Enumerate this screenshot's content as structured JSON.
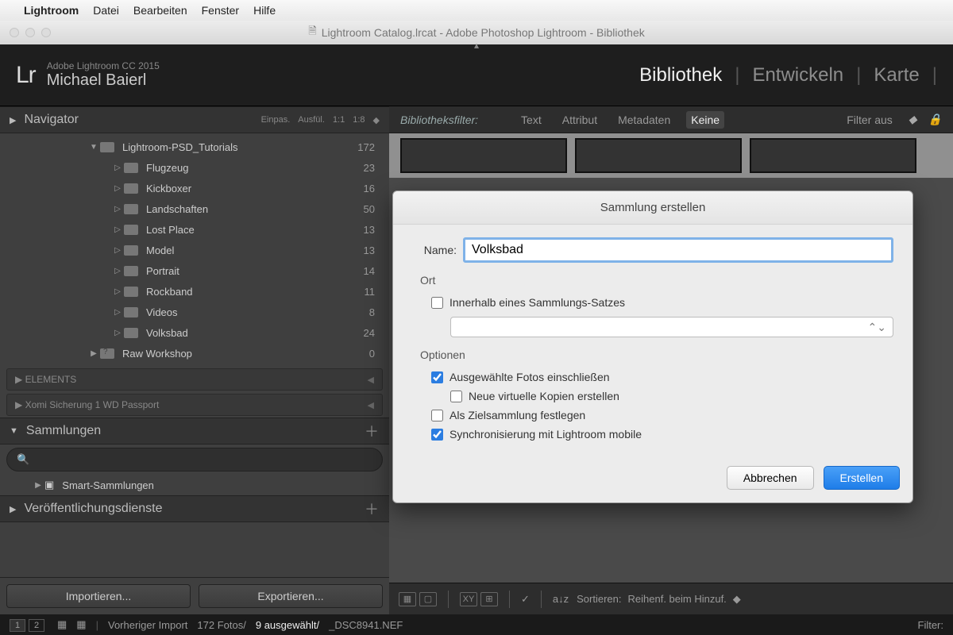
{
  "mac_menu": {
    "app": "Lightroom",
    "items": [
      "Datei",
      "Bearbeiten",
      "Fenster",
      "Hilfe"
    ]
  },
  "window_title": "Lightroom Catalog.lrcat - Adobe Photoshop Lightroom - Bibliothek",
  "identity": {
    "version": "Adobe Lightroom CC 2015",
    "user": "Michael Baierl",
    "logo": "Lr"
  },
  "modules": {
    "active": "Bibliothek",
    "m2": "Entwickeln",
    "m3": "Karte"
  },
  "navigator": {
    "title": "Navigator",
    "controls": [
      "Einpas.",
      "Ausfül.",
      "1:1",
      "1:8"
    ]
  },
  "folders": {
    "root": {
      "label": "Lightroom-PSD_Tutorials",
      "count": "172"
    },
    "children": [
      {
        "label": "Flugzeug",
        "count": "23"
      },
      {
        "label": "Kickboxer",
        "count": "16"
      },
      {
        "label": "Landschaften",
        "count": "50"
      },
      {
        "label": "Lost Place",
        "count": "13"
      },
      {
        "label": "Model",
        "count": "13"
      },
      {
        "label": "Portrait",
        "count": "14"
      },
      {
        "label": "Rockband",
        "count": "11"
      },
      {
        "label": "Videos",
        "count": "8"
      },
      {
        "label": "Volksbad",
        "count": "24"
      }
    ],
    "raw": {
      "label": "Raw Workshop",
      "count": "0"
    }
  },
  "elements_panel": "ELEMENTS",
  "drive_panel": "Xomi Sicherung 1 WD Passport",
  "sammlungen": {
    "title": "Sammlungen",
    "smart": "Smart-Sammlungen"
  },
  "publish": {
    "title": "Veröffentlichungsdienste"
  },
  "import_btn": "Importieren...",
  "export_btn": "Exportieren...",
  "lib_filter": {
    "label": "Bibliotheksfilter:",
    "items": [
      "Text",
      "Attribut",
      "Metadaten",
      "Keine"
    ],
    "filter_off": "Filter aus"
  },
  "dialog": {
    "title": "Sammlung erstellen",
    "name_label": "Name:",
    "name_value": "Volksbad",
    "ort": "Ort",
    "inside_set": "Innerhalb eines Sammlungs-Satzes",
    "optionen": "Optionen",
    "include": "Ausgewählte Fotos einschließen",
    "virtual": "Neue virtuelle Kopien erstellen",
    "target": "Als Zielsammlung festlegen",
    "sync": "Synchronisierung mit Lightroom mobile",
    "cancel": "Abbrechen",
    "create": "Erstellen"
  },
  "sort": {
    "label": "Sortieren:",
    "value": "Reihenf. beim Hinzuf."
  },
  "status": {
    "prev_import": "Vorheriger Import",
    "fotos": "172 Fotos/",
    "selected": "9 ausgewählt/",
    "file": "_DSC8941.NEF",
    "filter": "Filter:"
  }
}
